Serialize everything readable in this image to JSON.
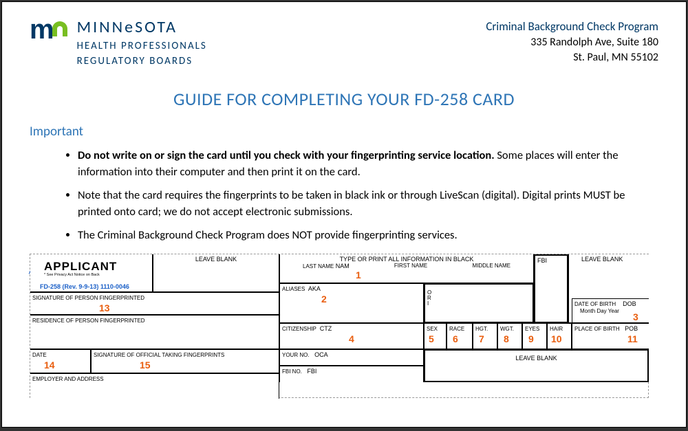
{
  "header": {
    "logo": {
      "name": "MINNeSOTA",
      "line2": "HEALTH PROFESSIONALS",
      "line3": "REGULATORY BOARDS"
    },
    "program": "Criminal Background Check Program",
    "addr1": "335 Randolph Ave, Suite 180",
    "addr2": "St. Paul, MN 55102"
  },
  "title": "GUIDE FOR COMPLETING YOUR FD-258 CARD",
  "important": "Important",
  "bullets": {
    "b1bold": "Do not write on or sign the card until you check with your fingerprinting service location.",
    "b1rest": " Some places will enter the information into their computer and then print it on the card.",
    "b2": "Note that the card requires the fingerprints to be taken in black ink or through LiveScan (digital). Digital prints MUST be printed onto card; we do not accept electronic submissions.",
    "b3": "The Criminal Background Check Program does NOT provide fingerprinting services."
  },
  "card": {
    "applicant": "APPLICANT",
    "app_sub": "* See Privacy Act Notice on Back",
    "fdline": "FD-258 (Rev. 9-9-13) 1110-0046",
    "leaveblank": "LEAVE BLANK",
    "type_header": "TYPE OR PRINT ALL INFORMATION IN BLACK",
    "lastname": "LAST NAME",
    "nam": "NAM",
    "firstname": "FIRST NAME",
    "middlename": "MIDDLE NAME",
    "fbi": "FBI",
    "sig": "SIGNATURE OF PERSON FINGERPRINTED",
    "aliases": "ALIASES",
    "aka": "AKA",
    "ori": "O R I",
    "residence": "RESIDENCE OF PERSON FINGERPRINTED",
    "dob": "DATE OF BIRTH",
    "dob_abbr": "DOB",
    "dob_mdy": "Month    Day    Year",
    "citizenship": "CITIZENSHIP",
    "ctz": "CTZ",
    "sex": "SEX",
    "race": "RACE",
    "hgt": "HGT.",
    "wgt": "WGT.",
    "eyes": "EYES",
    "hair": "HAIR",
    "pob": "PLACE OF BIRTH",
    "pob_abbr": "POB",
    "date": "DATE",
    "sig_official": "SIGNATURE OF OFFICIAL TAKING FINGERPRINTS",
    "yourno": "YOUR NO.",
    "oca": "OCA",
    "employer": "EMPLOYER AND ADDRESS",
    "fbino": "FBI NO.",
    "fbi_abbr": "FBI",
    "nums": {
      "n1": "1",
      "n2": "2",
      "n3": "3",
      "n4": "4",
      "n5": "5",
      "n6": "6",
      "n7": "7",
      "n8": "8",
      "n9": "9",
      "n10": "10",
      "n11": "11",
      "n13": "13",
      "n14": "14",
      "n15": "15"
    }
  }
}
